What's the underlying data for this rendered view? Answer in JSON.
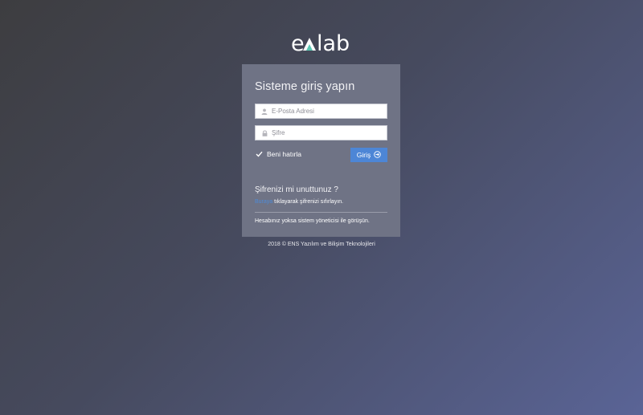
{
  "brand": {
    "logo_text_pre": "e",
    "logo_text_post": "lab",
    "accent_color": "#5bc8b3"
  },
  "login": {
    "title": "Sisteme giriş yapın",
    "email_placeholder": "E-Posta Adresi",
    "email_value": "",
    "password_placeholder": "Şifre",
    "password_value": "",
    "email_icon": "user-icon",
    "password_icon": "lock-icon",
    "remember_label": "Beni hatırla",
    "remember_checked": true,
    "login_button_label": "Giriş",
    "login_button_icon": "arrow-circle-right-icon",
    "button_color": "#4d86d6"
  },
  "forgot": {
    "title": "Şifrenizi mi unuttunuz ?",
    "link_text": "Buraya",
    "rest_text": " tıklayarak şifrenizi sıfırlayın."
  },
  "admin_note": "Hesabınız yoksa sistem yöneticisi ile görüşün.",
  "footer": {
    "text": "2018 © ENS Yazılım ve Bilişim Teknolojileri"
  }
}
